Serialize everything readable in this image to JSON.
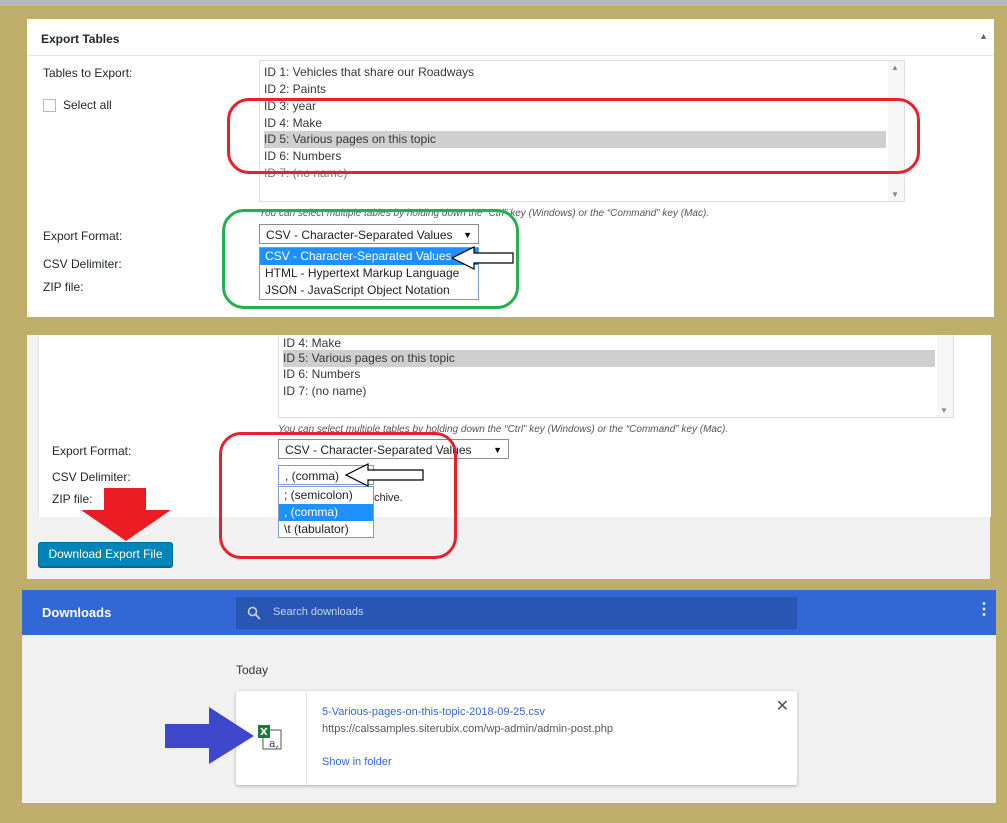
{
  "panel1": {
    "title": "Export Tables",
    "collapse_icon": "triangle-up",
    "tables_label": "Tables to Export:",
    "select_all_label": "Select all",
    "tables": [
      "ID 1: Vehicles that share our Roadways",
      "ID 2: Paints",
      "ID 3: year",
      "ID 4: Make",
      "ID 5: Various pages on this topic",
      "ID 6: Numbers",
      "ID 7: (no name)"
    ],
    "selected_table": "ID 5: Various pages on this topic",
    "hint": "You can select multiple tables by holding down the “Ctrl” key (Windows) or the “Command” key (Mac).",
    "export_format_label": "Export Format:",
    "csv_delimiter_label": "CSV Delimiter:",
    "zip_label": "ZIP file:",
    "format_value": "CSV - Character-Separated Values",
    "format_options": [
      "CSV - Character-Separated Values",
      "HTML - Hypertext Markup Language",
      "JSON - JavaScript Object Notation"
    ]
  },
  "panel2": {
    "tables": [
      "ID 4: Make",
      "ID 5: Various pages on this topic",
      "ID 6: Numbers",
      "ID 7: (no name)"
    ],
    "hint": "You can select multiple tables by holding down the “Ctrl” key (Windows) or the “Command” key (Mac).",
    "export_format_label": "Export Format:",
    "csv_delimiter_label": "CSV Delimiter:",
    "zip_label": "ZIP file:",
    "zip_hint_fragment": "chive.",
    "format_value": "CSV - Character-Separated Values",
    "delimiter_value": ", (comma)",
    "delimiter_options": [
      "; (semicolon)",
      ", (comma)",
      "\\t (tabulator)"
    ],
    "download_button": "Download Export File"
  },
  "downloads": {
    "title": "Downloads",
    "search_placeholder": "Search downloads",
    "menu_icon": "vertical-dots",
    "section": "Today",
    "file_name": "5-Various-pages-on-this-topic-2018-09-25.csv",
    "url": "https://calssamples.siterubix.com/wp-admin/admin-post.php",
    "show_in_folder": "Show in folder",
    "close_icon": "close"
  },
  "colors": {
    "red_ring": "#e8202a",
    "green_ring": "#22b14c",
    "blue_arrow": "#3f48cc",
    "chrome_blue": "#3367d6",
    "wp_button": "#0085ba",
    "highlight": "#1e90ff"
  }
}
